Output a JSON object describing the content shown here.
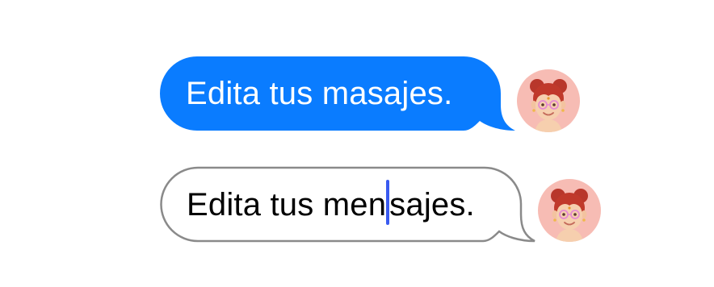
{
  "messages": [
    {
      "state": "sent",
      "text": "Edita tus masajes.",
      "bubble_color": "#0a7cff",
      "text_color": "#ffffff"
    },
    {
      "state": "editing",
      "text_before_caret": "Edita tus men",
      "text_after_caret": "sajes.",
      "border_color": "#8a8a8a",
      "caret_color": "#3a5bf0",
      "text_color": "#000000"
    }
  ],
  "avatar": {
    "icon": "memoji-avatar-icon",
    "background_color": "#f7bcb4"
  }
}
